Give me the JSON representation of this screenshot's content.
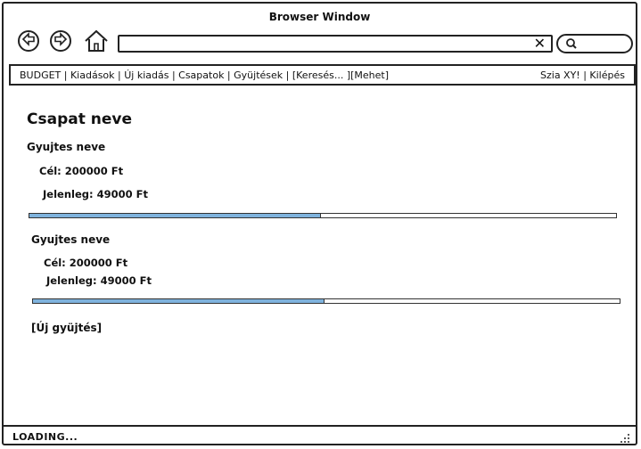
{
  "window": {
    "title": "Browser Window"
  },
  "address_bar": {
    "value": "",
    "clear_icon": "✕"
  },
  "menu": {
    "left_text": "BUDGET | Kiadások | Új kiadás | Csapatok | Gyüjtések | [Keresés...     ][Mehet]",
    "right_text": "Szia XY! | Kilépés"
  },
  "page": {
    "team_name": "Csapat neve",
    "collections": [
      {
        "name": "Gyujtes neve",
        "goal_text": "Cél: 200000 Ft",
        "current_text": "Jelenleg: 49000 Ft",
        "progress": 0.495
      },
      {
        "name": "Gyujtes neve",
        "goal_text": "Cél: 200000 Ft",
        "current_text": "Jelenleg: 49000 Ft",
        "progress": 0.495
      }
    ],
    "new_collection_label": "[Új gyüjtés]"
  },
  "status": {
    "text": "LOADING..."
  },
  "colors": {
    "progress_fill": "#7fb3dd"
  }
}
